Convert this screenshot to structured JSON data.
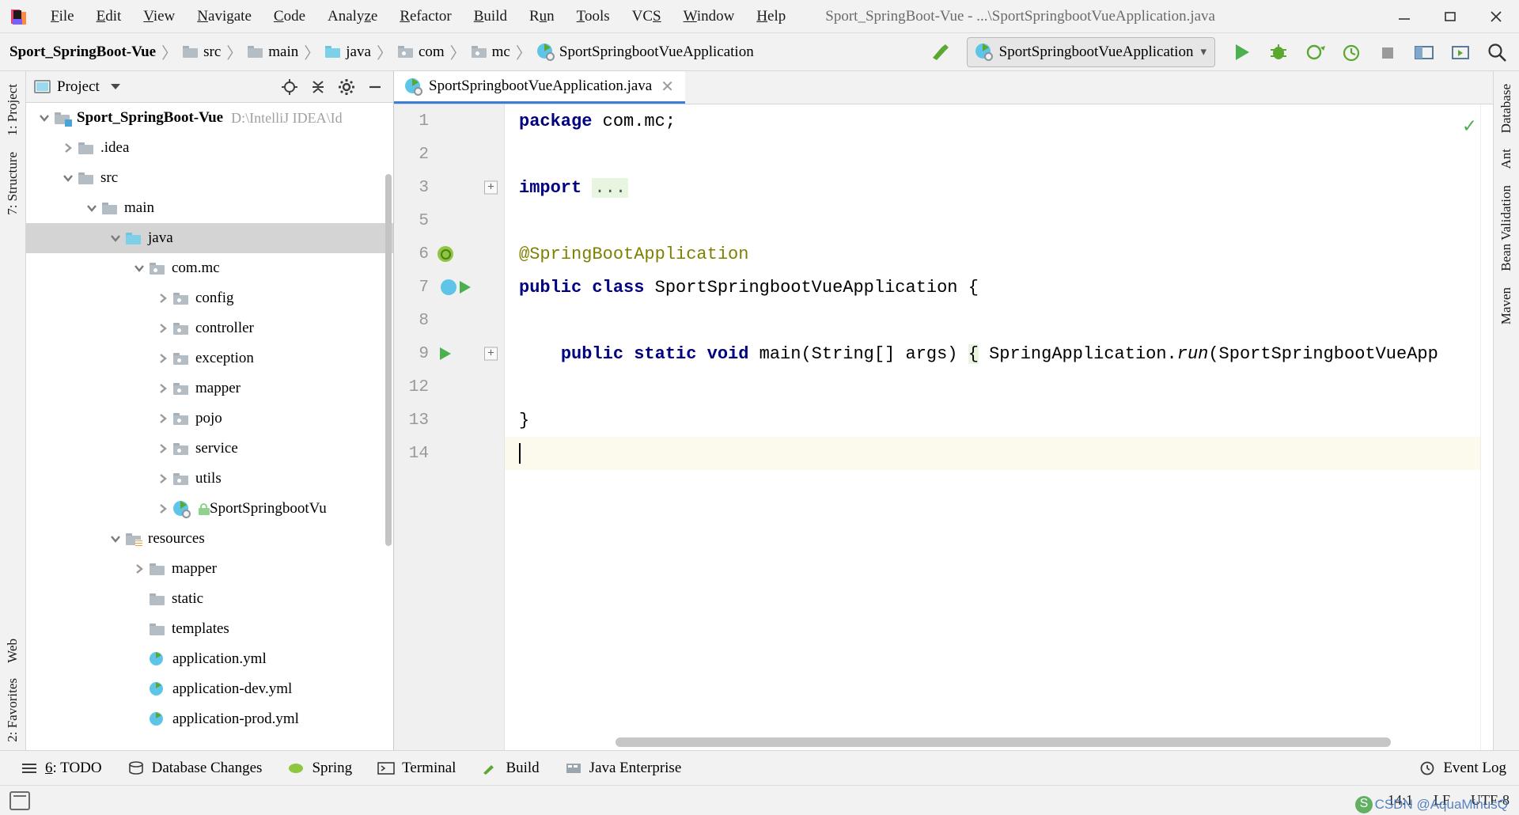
{
  "window": {
    "title": "Sport_SpringBoot-Vue - ...\\SportSpringbootVueApplication.java",
    "app_icon": "intellij-idea-icon",
    "controls": {
      "minimize": "minimize-icon",
      "maximize": "maximize-icon",
      "close": "close-icon"
    }
  },
  "menu": [
    {
      "label": "File",
      "mnemonic": "F"
    },
    {
      "label": "Edit",
      "mnemonic": "E"
    },
    {
      "label": "View",
      "mnemonic": "V"
    },
    {
      "label": "Navigate",
      "mnemonic": "N"
    },
    {
      "label": "Code",
      "mnemonic": "C"
    },
    {
      "label": "Analyze",
      "mnemonic": "z"
    },
    {
      "label": "Refactor",
      "mnemonic": "R"
    },
    {
      "label": "Build",
      "mnemonic": "B"
    },
    {
      "label": "Run",
      "mnemonic": "u"
    },
    {
      "label": "Tools",
      "mnemonic": "T"
    },
    {
      "label": "VCS",
      "mnemonic": "S"
    },
    {
      "label": "Window",
      "mnemonic": "W"
    },
    {
      "label": "Help",
      "mnemonic": "H"
    }
  ],
  "breadcrumbs": [
    {
      "label": "Sport_SpringBoot-Vue",
      "icon": "none"
    },
    {
      "label": "src",
      "icon": "folder-icon"
    },
    {
      "label": "main",
      "icon": "folder-icon"
    },
    {
      "label": "java",
      "icon": "folder-source-icon"
    },
    {
      "label": "com",
      "icon": "package-icon"
    },
    {
      "label": "mc",
      "icon": "package-icon"
    },
    {
      "label": "SportSpringbootVueApplication",
      "icon": "spring-boot-class-icon"
    }
  ],
  "toolbar": {
    "run_config": "SportSpringbootVueApplication",
    "run_config_icon": "spring-boot-icon",
    "buttons": [
      "build-icon",
      "run-button",
      "debug-button",
      "run-coverage-button",
      "profile-button",
      "stop-button",
      "update-project-button",
      "select-opened-file-button",
      "search-everywhere-button"
    ]
  },
  "left_strip": [
    {
      "label": "1: Project",
      "icon": "project-icon"
    },
    {
      "label": "7: Structure",
      "icon": "structure-icon"
    },
    {
      "label": "Web",
      "icon": "web-icon"
    },
    {
      "label": "2: Favorites",
      "icon": "favorites-icon"
    }
  ],
  "right_strip": [
    {
      "label": "Database",
      "icon": "database-icon"
    },
    {
      "label": "Ant",
      "icon": "ant-icon"
    },
    {
      "label": "Bean Validation",
      "icon": "bean-validation-icon"
    },
    {
      "label": "Maven",
      "icon": "maven-icon"
    }
  ],
  "project_panel": {
    "title": "Project",
    "title_icon": "project-window-icon",
    "actions": [
      "locate-icon",
      "collapse-all-icon",
      "settings-icon",
      "hide-icon"
    ],
    "tree": [
      {
        "label": "Sport_SpringBoot-Vue",
        "path": "D:\\IntelliJ IDEA\\Id",
        "indent": 0,
        "state": "expanded",
        "icon": "module-icon",
        "bold": true
      },
      {
        "label": ".idea",
        "indent": 1,
        "state": "collapsed",
        "icon": "folder-icon"
      },
      {
        "label": "src",
        "indent": 1,
        "state": "expanded",
        "icon": "folder-icon"
      },
      {
        "label": "main",
        "indent": 2,
        "state": "expanded",
        "icon": "folder-icon"
      },
      {
        "label": "java",
        "indent": 3,
        "state": "expanded",
        "icon": "source-folder-icon",
        "selected": true
      },
      {
        "label": "com.mc",
        "indent": 4,
        "state": "expanded",
        "icon": "package-icon"
      },
      {
        "label": "config",
        "indent": 5,
        "state": "collapsed",
        "icon": "package-icon"
      },
      {
        "label": "controller",
        "indent": 5,
        "state": "collapsed",
        "icon": "package-icon"
      },
      {
        "label": "exception",
        "indent": 5,
        "state": "collapsed",
        "icon": "package-icon"
      },
      {
        "label": "mapper",
        "indent": 5,
        "state": "collapsed",
        "icon": "package-icon"
      },
      {
        "label": "pojo",
        "indent": 5,
        "state": "collapsed",
        "icon": "package-icon"
      },
      {
        "label": "service",
        "indent": 5,
        "state": "collapsed",
        "icon": "package-icon"
      },
      {
        "label": "utils",
        "indent": 5,
        "state": "collapsed",
        "icon": "package-icon"
      },
      {
        "label": "SportSpringbootVu",
        "indent": 5,
        "state": "collapsed",
        "icon": "spring-boot-class-icon",
        "lock": true
      },
      {
        "label": "resources",
        "indent": 3,
        "state": "expanded",
        "icon": "resources-folder-icon"
      },
      {
        "label": "mapper",
        "indent": 4,
        "state": "collapsed",
        "icon": "folder-icon"
      },
      {
        "label": "static",
        "indent": 4,
        "state": "leaf",
        "icon": "folder-icon"
      },
      {
        "label": "templates",
        "indent": 4,
        "state": "leaf",
        "icon": "folder-icon"
      },
      {
        "label": "application.yml",
        "indent": 4,
        "state": "leaf",
        "icon": "spring-yaml-icon"
      },
      {
        "label": "application-dev.yml",
        "indent": 4,
        "state": "leaf",
        "icon": "spring-yaml-icon"
      },
      {
        "label": "application-prod.yml",
        "indent": 4,
        "state": "leaf",
        "icon": "spring-yaml-icon"
      }
    ]
  },
  "editor": {
    "tab": {
      "label": "SportSpringbootVueApplication.java",
      "icon": "spring-boot-class-icon",
      "close": "close-icon"
    },
    "inspection_status": "ok-check-icon",
    "lines": [
      {
        "num": "1",
        "gutter": "",
        "fold": "",
        "tokens": [
          {
            "t": "package",
            "c": "kw"
          },
          {
            "t": " com.mc;",
            "c": "pl"
          }
        ]
      },
      {
        "num": "2",
        "gutter": "",
        "fold": "",
        "tokens": []
      },
      {
        "num": "3",
        "gutter": "",
        "fold": "plus",
        "tokens": [
          {
            "t": "import",
            "c": "kw"
          },
          {
            "t": " ",
            "c": "pl"
          },
          {
            "t": "...",
            "c": "fold"
          }
        ]
      },
      {
        "num": "5",
        "gutter": "",
        "fold": "",
        "tokens": []
      },
      {
        "num": "6",
        "gutter": "spring",
        "fold": "",
        "tokens": [
          {
            "t": "@SpringBootApplication",
            "c": "ann"
          }
        ]
      },
      {
        "num": "7",
        "gutter": "spring-run",
        "fold": "",
        "tokens": [
          {
            "t": "public class",
            "c": "kw"
          },
          {
            "t": " SportSpringbootVueApplication {",
            "c": "pl"
          }
        ]
      },
      {
        "num": "8",
        "gutter": "",
        "fold": "",
        "tokens": []
      },
      {
        "num": "9",
        "gutter": "run",
        "fold": "plus",
        "tokens": [
          {
            "t": "    ",
            "c": "pl"
          },
          {
            "t": "public static void",
            "c": "kw"
          },
          {
            "t": " main(String[] args) ",
            "c": "pl"
          },
          {
            "t": "{",
            "c": "brace"
          },
          {
            "t": " SpringApplication.",
            "c": "pl"
          },
          {
            "t": "run",
            "c": "ital"
          },
          {
            "t": "(SportSpringbootVueApp",
            "c": "pl"
          }
        ]
      },
      {
        "num": "12",
        "gutter": "",
        "fold": "",
        "tokens": []
      },
      {
        "num": "13",
        "gutter": "",
        "fold": "",
        "tokens": [
          {
            "t": "}",
            "c": "pl"
          }
        ]
      },
      {
        "num": "14",
        "gutter": "",
        "fold": "",
        "current": true,
        "tokens": []
      }
    ]
  },
  "tool_windows": [
    {
      "label": "6: TODO",
      "icon": "todo-icon",
      "mnemonic": "6"
    },
    {
      "label": "Database Changes",
      "icon": "database-changes-icon"
    },
    {
      "label": "Spring",
      "icon": "spring-icon"
    },
    {
      "label": "Terminal",
      "icon": "terminal-icon"
    },
    {
      "label": "Build",
      "icon": "build-icon"
    },
    {
      "label": "Java Enterprise",
      "icon": "java-enterprise-icon"
    },
    {
      "label": "Event Log",
      "icon": "event-log-icon"
    }
  ],
  "status_bar": {
    "left_icon": "toggle-toolbar-icon",
    "caret": "14:1",
    "line_separator": "LF",
    "encoding": "UTF-8",
    "watermark": "CSDN @AquaMinusQ"
  }
}
